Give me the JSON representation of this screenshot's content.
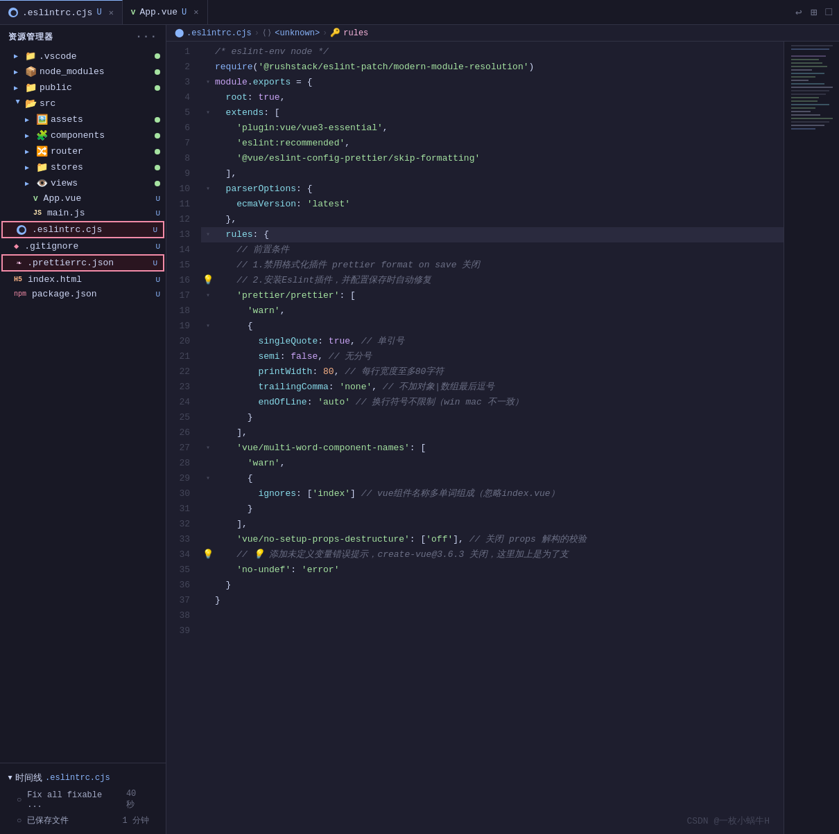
{
  "tabBar": {
    "tabs": [
      {
        "id": "eslintrc",
        "label": ".eslintrc.cjs",
        "badge": "U",
        "active": true,
        "iconType": "eslint"
      },
      {
        "id": "appvue",
        "label": "App.vue",
        "badge": "U",
        "active": false,
        "iconType": "vue"
      }
    ],
    "actions": [
      "↩",
      "⊞",
      "□"
    ]
  },
  "breadcrumb": {
    "items": [
      {
        "label": ".eslintrc.cjs",
        "type": "file"
      },
      {
        "label": "<unknown>",
        "type": "unknown"
      },
      {
        "label": "rules",
        "type": "property"
      }
    ]
  },
  "sidebar": {
    "title": "资源管理器",
    "items": [
      {
        "id": "vscode",
        "label": ".vscode",
        "type": "folder",
        "indent": 1,
        "expanded": false,
        "dot": "green"
      },
      {
        "id": "node_modules",
        "label": "node_modules",
        "type": "folder",
        "indent": 1,
        "expanded": false,
        "dot": "green"
      },
      {
        "id": "public",
        "label": "public",
        "type": "folder",
        "indent": 1,
        "expanded": false,
        "dot": "green"
      },
      {
        "id": "src",
        "label": "src",
        "type": "folder",
        "indent": 1,
        "expanded": true,
        "dot": ""
      },
      {
        "id": "assets",
        "label": "assets",
        "type": "folder",
        "indent": 2,
        "expanded": false,
        "dot": "green"
      },
      {
        "id": "components",
        "label": "components",
        "type": "folder",
        "indent": 2,
        "expanded": false,
        "dot": "green"
      },
      {
        "id": "router",
        "label": "router",
        "type": "folder",
        "indent": 2,
        "expanded": false,
        "dot": "green"
      },
      {
        "id": "stores",
        "label": "stores",
        "type": "folder",
        "indent": 2,
        "expanded": false,
        "dot": "green"
      },
      {
        "id": "views",
        "label": "views",
        "type": "folder",
        "indent": 2,
        "expanded": false,
        "dot": "green"
      },
      {
        "id": "appvue",
        "label": "App.vue",
        "type": "vue",
        "indent": 2,
        "badge": "U"
      },
      {
        "id": "mainjs",
        "label": "main.js",
        "type": "js",
        "indent": 2,
        "badge": "U"
      },
      {
        "id": "eslintrc",
        "label": ".eslintrc.cjs",
        "type": "eslint",
        "indent": 1,
        "badge": "U",
        "selected": true,
        "highlighted": true
      },
      {
        "id": "gitignore",
        "label": ".gitignore",
        "type": "file",
        "indent": 1,
        "badge": "U"
      },
      {
        "id": "prettierrc",
        "label": ".prettierrc.json",
        "type": "json",
        "indent": 1,
        "badge": "U",
        "highlighted": true
      },
      {
        "id": "indexhtml",
        "label": "index.html",
        "type": "html",
        "indent": 1,
        "badge": "U"
      },
      {
        "id": "packagejson",
        "label": "package.json",
        "type": "json",
        "indent": 1,
        "badge": "U"
      }
    ],
    "timeline": {
      "header": "时间线",
      "file": ".eslintrc.cjs",
      "entries": [
        {
          "label": "Fix all fixable ...",
          "time": "40 秒"
        },
        {
          "label": "已保存文件",
          "time": "1 分钟"
        }
      ]
    }
  },
  "editor": {
    "lines": [
      {
        "n": 1,
        "tokens": [
          {
            "t": "comment",
            "v": "/* eslint-env node */"
          }
        ]
      },
      {
        "n": 2,
        "tokens": [
          {
            "t": "func",
            "v": "require"
          },
          {
            "t": "punct",
            "v": "("
          },
          {
            "t": "string",
            "v": "'@rushstack/eslint-patch/modern-module-resolution'"
          },
          {
            "t": "punct",
            "v": ")"
          }
        ]
      },
      {
        "n": 3,
        "tokens": []
      },
      {
        "n": 4,
        "tokens": [
          {
            "t": "keyword",
            "v": "module"
          },
          {
            "t": "punct",
            "v": "."
          },
          {
            "t": "property",
            "v": "exports"
          },
          {
            "t": "punct",
            "v": " = {"
          }
        ],
        "collapsible": true
      },
      {
        "n": 5,
        "tokens": [
          {
            "t": "property",
            "v": "  root"
          },
          {
            "t": "punct",
            "v": ": "
          },
          {
            "t": "keyword",
            "v": "true"
          },
          {
            "t": "punct",
            "v": ","
          }
        ]
      },
      {
        "n": 6,
        "tokens": [
          {
            "t": "property",
            "v": "  extends"
          },
          {
            "t": "punct",
            "v": ": ["
          }
        ],
        "collapsible": true
      },
      {
        "n": 7,
        "tokens": [
          {
            "t": "string",
            "v": "    'plugin:vue/vue3-essential'"
          },
          {
            "t": "punct",
            "v": ","
          }
        ]
      },
      {
        "n": 8,
        "tokens": [
          {
            "t": "string",
            "v": "    'eslint:recommended'"
          },
          {
            "t": "punct",
            "v": ","
          }
        ]
      },
      {
        "n": 9,
        "tokens": [
          {
            "t": "string",
            "v": "    '@vue/eslint-config-prettier/skip-formatting'"
          }
        ]
      },
      {
        "n": 10,
        "tokens": [
          {
            "t": "punct",
            "v": "  ],"
          }
        ]
      },
      {
        "n": 11,
        "tokens": [
          {
            "t": "property",
            "v": "  parserOptions"
          },
          {
            "t": "punct",
            "v": ": {"
          }
        ],
        "collapsible": true
      },
      {
        "n": 12,
        "tokens": [
          {
            "t": "property",
            "v": "    ecmaVersion"
          },
          {
            "t": "punct",
            "v": ": "
          },
          {
            "t": "string",
            "v": "'latest'"
          }
        ]
      },
      {
        "n": 13,
        "tokens": [
          {
            "t": "punct",
            "v": "  },"
          }
        ]
      },
      {
        "n": 14,
        "tokens": [
          {
            "t": "property",
            "v": "  rules"
          },
          {
            "t": "punct",
            "v": ": {"
          }
        ],
        "collapsible": true,
        "highlighted": true
      },
      {
        "n": 15,
        "tokens": [
          {
            "t": "comment",
            "v": "    // 前置条件"
          }
        ]
      },
      {
        "n": 16,
        "tokens": [
          {
            "t": "comment",
            "v": "    // 1.禁用格式化插件 prettier format on save 关闭"
          }
        ]
      },
      {
        "n": 17,
        "tokens": [
          {
            "t": "comment",
            "v": "    // 2.安装Eslint插件，并配置保存时自动修复"
          }
        ],
        "bulb": true
      },
      {
        "n": 18,
        "tokens": [
          {
            "t": "string",
            "v": "    'prettier/prettier'"
          },
          {
            "t": "punct",
            "v": ": ["
          }
        ],
        "collapsible": true
      },
      {
        "n": 19,
        "tokens": [
          {
            "t": "string",
            "v": "      'warn'"
          },
          {
            "t": "punct",
            "v": ","
          }
        ]
      },
      {
        "n": 20,
        "tokens": [
          {
            "t": "punct",
            "v": "      {"
          }
        ],
        "collapsible": true
      },
      {
        "n": 21,
        "tokens": [
          {
            "t": "property",
            "v": "        singleQuote"
          },
          {
            "t": "punct",
            "v": ": "
          },
          {
            "t": "keyword",
            "v": "true"
          },
          {
            "t": "punct",
            "v": ", "
          },
          {
            "t": "comment",
            "v": "// 单引号"
          }
        ]
      },
      {
        "n": 22,
        "tokens": [
          {
            "t": "property",
            "v": "        semi"
          },
          {
            "t": "punct",
            "v": ": "
          },
          {
            "t": "keyword",
            "v": "false"
          },
          {
            "t": "punct",
            "v": ", "
          },
          {
            "t": "comment",
            "v": "// 无分号"
          }
        ]
      },
      {
        "n": 23,
        "tokens": [
          {
            "t": "property",
            "v": "        printWidth"
          },
          {
            "t": "punct",
            "v": ": "
          },
          {
            "t": "number",
            "v": "80"
          },
          {
            "t": "punct",
            "v": ", "
          },
          {
            "t": "comment",
            "v": "// 每行宽度至多80字符"
          }
        ]
      },
      {
        "n": 24,
        "tokens": [
          {
            "t": "property",
            "v": "        trailingComma"
          },
          {
            "t": "punct",
            "v": ": "
          },
          {
            "t": "string",
            "v": "'none'"
          },
          {
            "t": "punct",
            "v": ", "
          },
          {
            "t": "comment",
            "v": "// 不加对象|数组最后逗号"
          }
        ]
      },
      {
        "n": 25,
        "tokens": [
          {
            "t": "property",
            "v": "        endOfLine"
          },
          {
            "t": "punct",
            "v": ": "
          },
          {
            "t": "string",
            "v": "'auto'"
          },
          {
            "t": "punct",
            "v": " "
          },
          {
            "t": "comment",
            "v": "// 换行符号不限制（win mac 不一致）"
          }
        ]
      },
      {
        "n": 26,
        "tokens": [
          {
            "t": "punct",
            "v": "      }"
          }
        ]
      },
      {
        "n": 27,
        "tokens": [
          {
            "t": "punct",
            "v": "    ],"
          }
        ]
      },
      {
        "n": 28,
        "tokens": [
          {
            "t": "string",
            "v": "    'vue/multi-word-component-names'"
          },
          {
            "t": "punct",
            "v": ": ["
          }
        ],
        "collapsible": true
      },
      {
        "n": 29,
        "tokens": [
          {
            "t": "string",
            "v": "      'warn'"
          },
          {
            "t": "punct",
            "v": ","
          }
        ]
      },
      {
        "n": 30,
        "tokens": [
          {
            "t": "punct",
            "v": "      {"
          }
        ],
        "collapsible": true
      },
      {
        "n": 31,
        "tokens": [
          {
            "t": "property",
            "v": "        ignores"
          },
          {
            "t": "punct",
            "v": ": ["
          },
          {
            "t": "string",
            "v": "'index'"
          },
          {
            "t": "punct",
            "v": "] "
          },
          {
            "t": "comment",
            "v": "// vue组件名称多单词组成（忽略index.vue）"
          }
        ]
      },
      {
        "n": 32,
        "tokens": [
          {
            "t": "punct",
            "v": "      }"
          }
        ]
      },
      {
        "n": 33,
        "tokens": [
          {
            "t": "punct",
            "v": "    ],"
          }
        ]
      },
      {
        "n": 34,
        "tokens": [
          {
            "t": "string",
            "v": "    'vue/no-setup-props-destructure'"
          },
          {
            "t": "punct",
            "v": ": ["
          },
          {
            "t": "string",
            "v": "'off'"
          },
          {
            "t": "punct",
            "v": "], "
          },
          {
            "t": "comment",
            "v": "// 关闭 props 解构的校验"
          }
        ]
      },
      {
        "n": 35,
        "tokens": [
          {
            "t": "comment",
            "v": "    // 💡 添加未定义变量错误提示，create-vue@3.6.3 关闭，这里加上是为了支"
          }
        ],
        "bulb2": true
      },
      {
        "n": 36,
        "tokens": [
          {
            "t": "string",
            "v": "    'no-undef'"
          },
          {
            "t": "punct",
            "v": ": "
          },
          {
            "t": "string",
            "v": "'error'"
          }
        ]
      },
      {
        "n": 37,
        "tokens": [
          {
            "t": "punct",
            "v": "  }"
          }
        ]
      },
      {
        "n": 38,
        "tokens": [
          {
            "t": "punct",
            "v": "}"
          }
        ]
      },
      {
        "n": 39,
        "tokens": []
      }
    ]
  },
  "watermark": "CSDN @一枚小蜗牛H"
}
